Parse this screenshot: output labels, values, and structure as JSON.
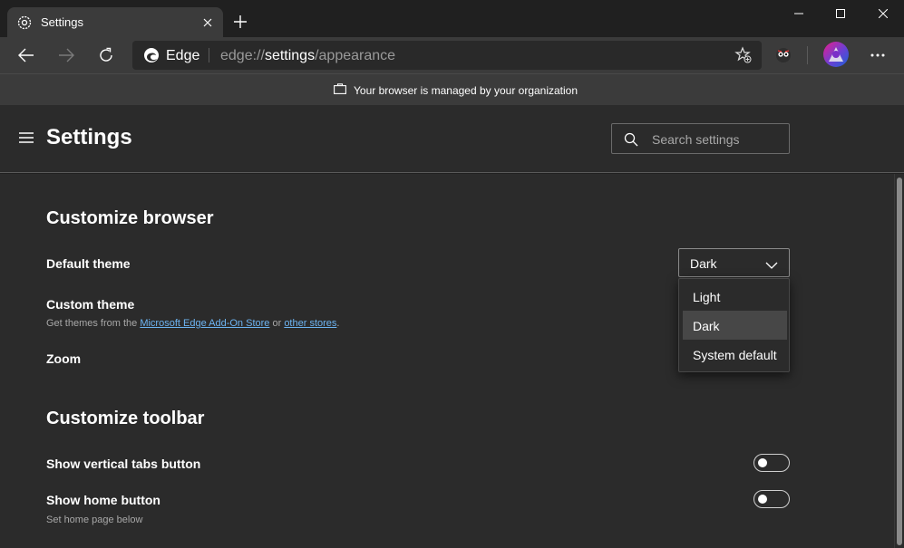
{
  "tab": {
    "title": "Settings"
  },
  "address": {
    "brand": "Edge",
    "url_prefix": "edge://",
    "url_highlight": "settings",
    "url_suffix": "/appearance"
  },
  "managed_bar": {
    "text": "Your browser is managed by your organization"
  },
  "header": {
    "title": "Settings",
    "search_placeholder": "Search settings"
  },
  "sections": {
    "customize_browser": {
      "heading": "Customize browser",
      "default_theme_label": "Default theme",
      "default_theme_value": "Dark",
      "theme_options": [
        "Light",
        "Dark",
        "System default"
      ],
      "custom_theme_label": "Custom theme",
      "custom_theme_text_1": "Get themes from the ",
      "custom_theme_link_1": "Microsoft Edge Add-On Store",
      "custom_theme_text_2": " or ",
      "custom_theme_link_2": "other stores",
      "custom_theme_text_3": ".",
      "zoom_label": "Zoom"
    },
    "customize_toolbar": {
      "heading": "Customize toolbar",
      "vertical_tabs_label": "Show vertical tabs button",
      "vertical_tabs_on": false,
      "home_button_label": "Show home button",
      "home_button_on": false,
      "home_button_sub": "Set home page below"
    }
  },
  "icons": {
    "tab": "gear-icon",
    "close": "close-icon",
    "new_tab": "plus-icon",
    "back": "back-arrow-icon",
    "forward": "forward-arrow-icon",
    "refresh": "refresh-icon",
    "favorite": "favorite-add-icon",
    "extension": "extension-icon",
    "more": "more-icon",
    "menu": "hamburger-menu-icon",
    "search": "search-icon",
    "managed": "briefcase-icon"
  }
}
